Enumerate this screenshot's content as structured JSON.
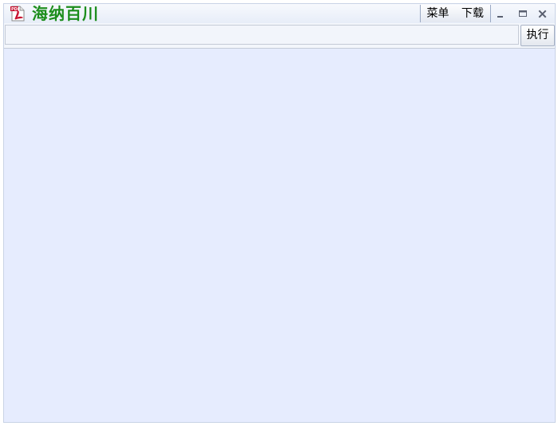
{
  "window": {
    "title": "海纳百川",
    "icon": "pdf-document-icon"
  },
  "toolbar": {
    "menu_label": "菜单",
    "download_label": "下载"
  },
  "window_controls": {
    "minimize_icon": "minimize-icon",
    "maximize_icon": "maximize-icon",
    "close_icon": "close-icon"
  },
  "command_bar": {
    "input_value": "",
    "input_placeholder": "",
    "execute_label": "执行"
  },
  "colors": {
    "title_text": "#1c8d1c",
    "content_background": "#e6ecfe"
  }
}
